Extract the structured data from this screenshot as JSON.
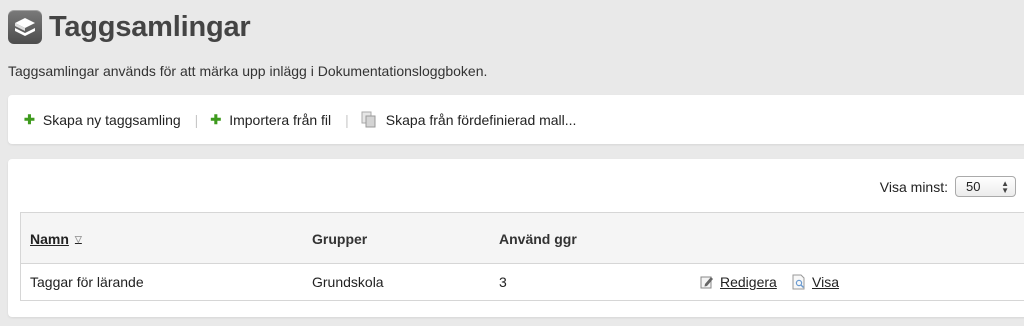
{
  "header": {
    "title": "Taggsamlingar",
    "description": "Taggsamlingar används för att märka upp inlägg i Dokumentationsloggboken.",
    "icon": "tag-collection-icon"
  },
  "toolbar": {
    "create_new": "Skapa ny taggsamling",
    "import_file": "Importera från fil",
    "create_from_template": "Skapa från fördefinierad mall...",
    "separator": "|"
  },
  "list": {
    "limit_label": "Visa minst:",
    "limit_value": "50",
    "columns": {
      "name": "Namn",
      "groups": "Grupper",
      "used": "Använd ggr"
    },
    "rows": [
      {
        "name": "Taggar för lärande",
        "groups": "Grundskola",
        "used": "3",
        "edit_label": "Redigera",
        "view_label": "Visa"
      }
    ]
  },
  "colors": {
    "background": "#e9e9e9",
    "panel": "#ffffff",
    "plus_icon": "#3e9a1d",
    "header_row": "#f5f5f5"
  }
}
